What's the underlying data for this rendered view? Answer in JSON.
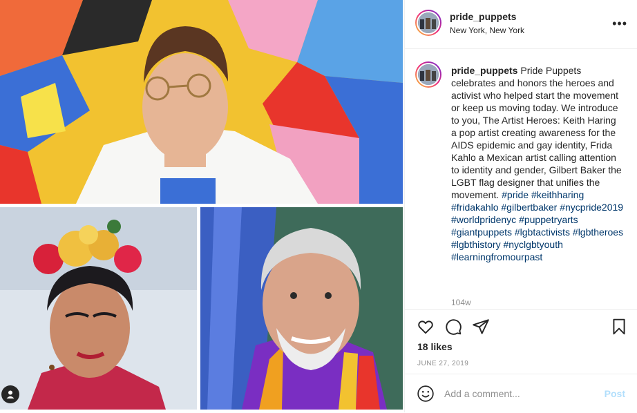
{
  "post": {
    "username": "pride_puppets",
    "location": "New York, New York",
    "more_icon": "more-horizontal-icon"
  },
  "caption": {
    "username": "pride_puppets",
    "text": "Pride Puppets celebrates and honors the heroes and activist who helped start the movement or keep us moving today. We introduce to you, The Artist Heroes: Keith Haring a pop artist creating awareness for the AIDS epidemic and gay identity, Frida Kahlo a Mexican artist calling attention to identity and gender, Gilbert Baker the LGBT flag designer that unifies the movement.",
    "hashtags": [
      "#pride",
      "#keithharing",
      "#fridakahlo",
      "#gilbertbaker",
      "#nycpride2019",
      "#worldpridenyc",
      "#puppetryarts",
      "#giantpuppets",
      "#lgbtactivists",
      "#lgbtheroes",
      "#lgbthistory",
      "#nyclgbtyouth",
      "#learningfromourpast"
    ],
    "time": "104w"
  },
  "stats": {
    "likes": "18 likes",
    "date": "JUNE 27, 2019"
  },
  "comment": {
    "placeholder": "Add a comment...",
    "post_label": "Post"
  },
  "colors": {
    "hashtag": "#00376b",
    "post_disabled": "#b2dffc",
    "muted": "#8e8e8e",
    "border": "#efefef"
  }
}
